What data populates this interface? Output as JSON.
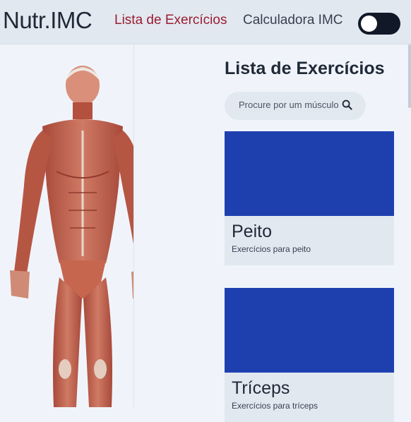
{
  "navbar": {
    "brand": "Nutr.IMC",
    "links": [
      {
        "label": "Lista de Exercícios",
        "active": true
      },
      {
        "label": "Calculadora IMC",
        "active": false
      }
    ],
    "theme_toggle": {
      "icon": "toggle-switch",
      "state": "off"
    }
  },
  "anatomy_figure": {
    "icon": "human-muscle-anatomy-illustration"
  },
  "main": {
    "title": "Lista de Exercícios",
    "search": {
      "placeholder": "Procure por um músculo",
      "value": "",
      "icon": "search-icon"
    },
    "cards": [
      {
        "title": "Peito",
        "description": "Exercícios para peito",
        "image_color": "#1e40af"
      },
      {
        "title": "Tríceps",
        "description": "Exercícios para tríceps",
        "image_color": "#1e40af"
      }
    ]
  },
  "colors": {
    "accent": "#9b1c31",
    "navbar_bg": "#e2e8f0",
    "page_bg": "#f0f4fa",
    "card_image": "#1e40af"
  }
}
